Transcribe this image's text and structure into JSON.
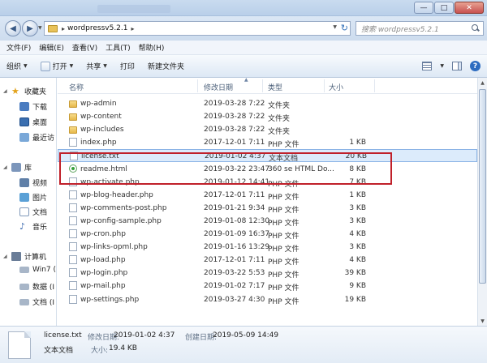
{
  "window": {
    "min_glyph": "—",
    "max_glyph": "□",
    "close_glyph": "✕"
  },
  "address": {
    "back_glyph": "◀",
    "forward_glyph": "▶",
    "path_sep": "▸",
    "path": "wordpressv5.2.1",
    "trailing_sep": "▸",
    "refresh_glyph": "↻",
    "search_placeholder": "搜索 wordpressv5.2.1"
  },
  "menu": [
    "文件(F)",
    "编辑(E)",
    "查看(V)",
    "工具(T)",
    "帮助(H)"
  ],
  "toolbar": {
    "organize": "组织",
    "open": "打开",
    "share": "共享",
    "print": "打印",
    "new_folder": "新建文件夹",
    "help": "?"
  },
  "nav": {
    "favorites": "收藏夹",
    "downloads": "下载",
    "desktop": "桌面",
    "recent": "最近访",
    "libraries": "库",
    "videos": "视频",
    "pictures": "图片",
    "documents": "文档",
    "music": "音乐",
    "computer": "计算机",
    "drive1": "Win7 (",
    "drive2": "数据 (I",
    "drive3": "文档 (I"
  },
  "columns": {
    "name": "名称",
    "date": "修改日期",
    "type": "类型",
    "size": "大小"
  },
  "files": [
    {
      "name": "wp-admin",
      "date": "2019-03-28 7:22",
      "type": "文件夹",
      "size": "",
      "kind": "folder"
    },
    {
      "name": "wp-content",
      "date": "2019-03-28 7:22",
      "type": "文件夹",
      "size": "",
      "kind": "folder"
    },
    {
      "name": "wp-includes",
      "date": "2019-03-28 7:22",
      "type": "文件夹",
      "size": "",
      "kind": "folder"
    },
    {
      "name": "index.php",
      "date": "2017-12-01 7:11",
      "type": "PHP 文件",
      "size": "1 KB",
      "kind": "file"
    },
    {
      "name": "license.txt",
      "date": "2019-01-02 4:37",
      "type": "文本文档",
      "size": "20 KB",
      "kind": "file",
      "selected": true
    },
    {
      "name": "readme.html",
      "date": "2019-03-22 23:47",
      "type": "360 se HTML Do...",
      "size": "8 KB",
      "kind": "html"
    },
    {
      "name": "wp-activate.php",
      "date": "2019-01-12 14:41",
      "type": "PHP 文件",
      "size": "7 KB",
      "kind": "file"
    },
    {
      "name": "wp-blog-header.php",
      "date": "2017-12-01 7:11",
      "type": "PHP 文件",
      "size": "1 KB",
      "kind": "file"
    },
    {
      "name": "wp-comments-post.php",
      "date": "2019-01-21 9:34",
      "type": "PHP 文件",
      "size": "3 KB",
      "kind": "file"
    },
    {
      "name": "wp-config-sample.php",
      "date": "2019-01-08 12:30",
      "type": "PHP 文件",
      "size": "3 KB",
      "kind": "file"
    },
    {
      "name": "wp-cron.php",
      "date": "2019-01-09 16:37",
      "type": "PHP 文件",
      "size": "4 KB",
      "kind": "file"
    },
    {
      "name": "wp-links-opml.php",
      "date": "2019-01-16 13:29",
      "type": "PHP 文件",
      "size": "3 KB",
      "kind": "file"
    },
    {
      "name": "wp-load.php",
      "date": "2017-12-01 7:11",
      "type": "PHP 文件",
      "size": "4 KB",
      "kind": "file"
    },
    {
      "name": "wp-login.php",
      "date": "2019-03-22 5:53",
      "type": "PHP 文件",
      "size": "39 KB",
      "kind": "file"
    },
    {
      "name": "wp-mail.php",
      "date": "2019-01-02 7:17",
      "type": "PHP 文件",
      "size": "9 KB",
      "kind": "file"
    },
    {
      "name": "wp-settings.php",
      "date": "2019-03-27 4:30",
      "type": "PHP 文件",
      "size": "19 KB",
      "kind": "file"
    }
  ],
  "details": {
    "filename": "license.txt",
    "modified_label": "修改日期:",
    "modified": "2019-01-02 4:37",
    "created_label": "创建日期:",
    "created": "2019-05-09 14:49",
    "type": "文本文档",
    "size_label": "大小:",
    "size": "19.4 KB"
  },
  "colors": {
    "highlight_box": "#c0202a",
    "selection": "#dcebfb"
  }
}
